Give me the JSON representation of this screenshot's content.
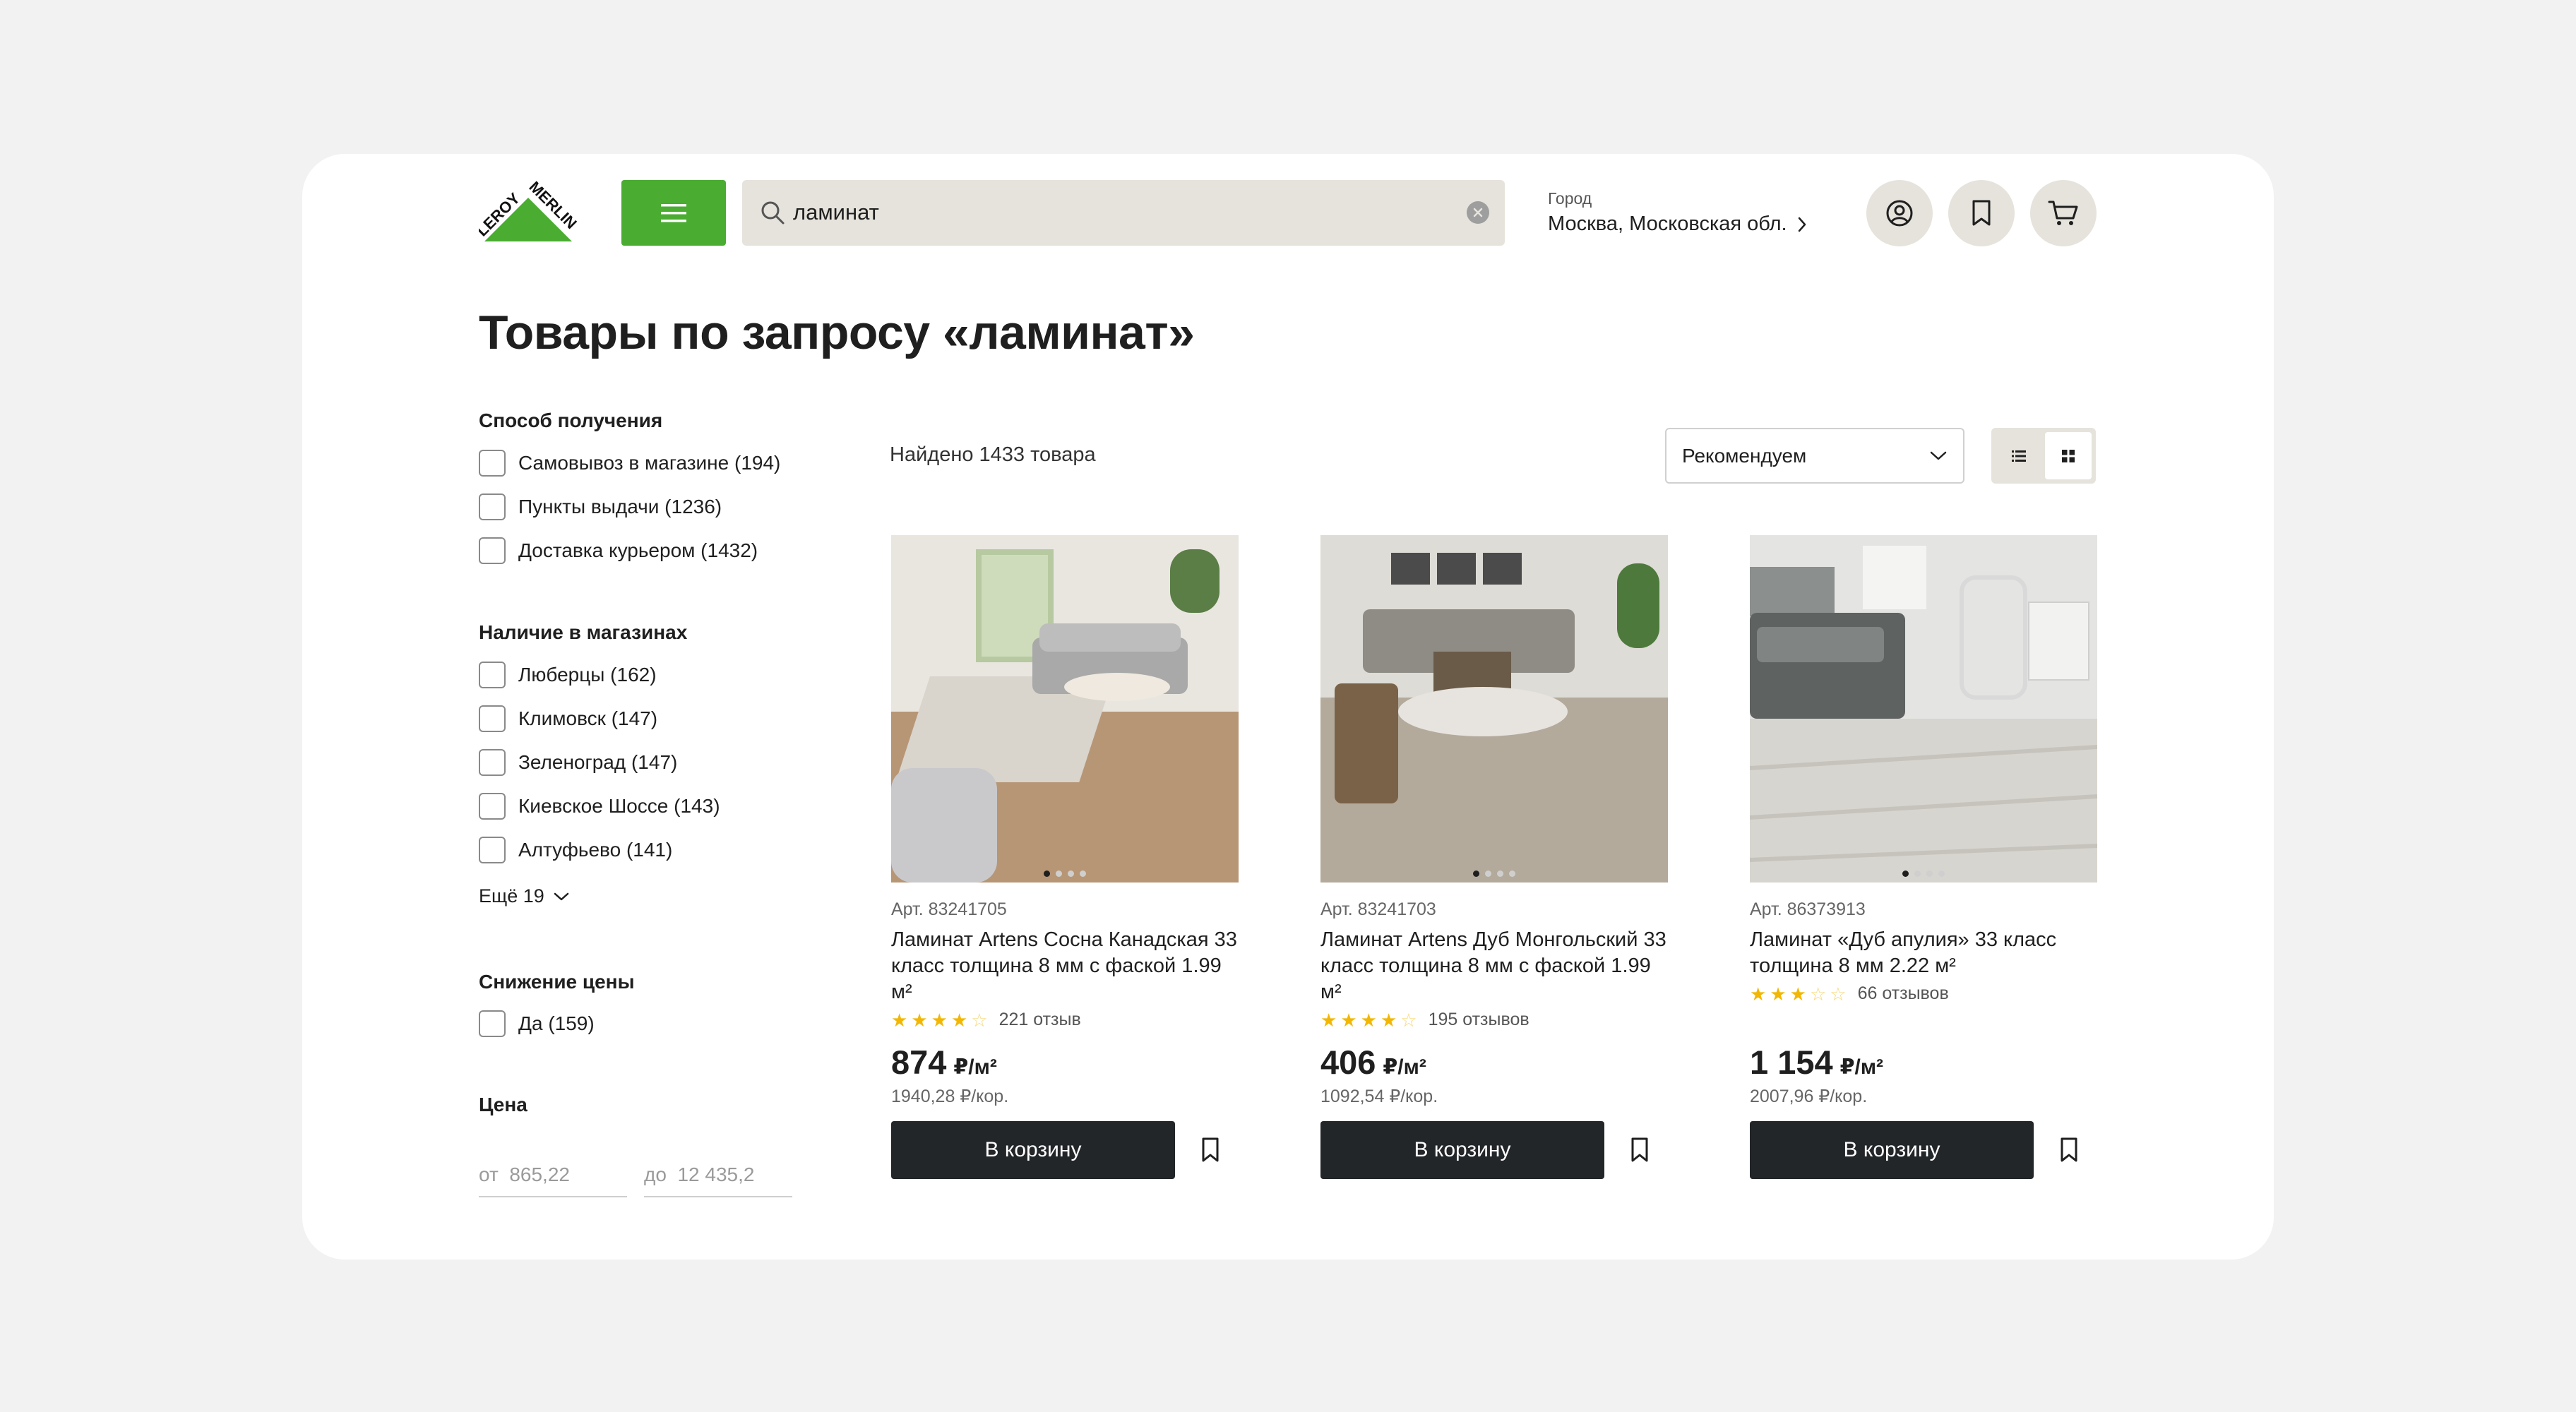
{
  "header": {
    "logo_text": "LEROY MERLIN",
    "search": {
      "value": "ламинат",
      "icon": "search-icon",
      "clear_icon": "clear-icon"
    },
    "city": {
      "label": "Город",
      "value": "Москва, Московская обл."
    },
    "icons": [
      "menu-icon",
      "profile-icon",
      "bookmark-icon",
      "cart-icon"
    ],
    "brand_color": "#4aad32"
  },
  "page_title": "Товары по запросу «ламинат»",
  "filters": {
    "delivery": {
      "title": "Способ получения",
      "items": [
        "Самовывоз в магазине (194)",
        "Пункты выдачи (1236)",
        "Доставка курьером (1432)"
      ]
    },
    "stores": {
      "title": "Наличие в магазинах",
      "items": [
        "Люберцы (162)",
        "Климовск (147)",
        "Зеленоград (147)",
        "Киевское Шоссе (143)",
        "Алтуфьево (141)"
      ],
      "more": "Ещё 19"
    },
    "discount": {
      "title": "Снижение цены",
      "items": [
        "Да (159)"
      ]
    },
    "price": {
      "title": "Цена",
      "from_placeholder": "от  865,22",
      "to_placeholder": "до  12 435,2"
    }
  },
  "toolbar": {
    "found": "Найдено 1433 товара",
    "sort": "Рекомендуем",
    "view_modes": [
      "list-view-icon",
      "grid-view-icon"
    ],
    "active_view": "grid"
  },
  "products": [
    {
      "art": "Арт. 83241705",
      "name": "Ламинат Artens Сосна Канадская 33 класс толщина 8 мм с фаской 1.99 м²",
      "stars": 4,
      "reviews": "221 отзыв",
      "price": "874",
      "unit": "₽/м²",
      "per_box": "1940,28 ₽/кор.",
      "button": "В корзину",
      "image_slides": 4,
      "active_slide": 1
    },
    {
      "art": "Арт. 83241703",
      "name": "Ламинат Artens Дуб Монгольский 33 класс толщина 8 мм с фаской 1.99 м²",
      "stars": 4,
      "reviews": "195 отзывов",
      "price": "406",
      "unit": "₽/м²",
      "per_box": "1092,54 ₽/кор.",
      "button": "В корзину",
      "image_slides": 4,
      "active_slide": 1
    },
    {
      "art": "Арт. 86373913",
      "name": "Ламинат «Дуб апулия» 33 класс толщина 8 мм 2.22 м²",
      "stars": 3,
      "reviews": "66 отзывов",
      "price": "1 154",
      "unit": "₽/м²",
      "per_box": "2007,96 ₽/кор.",
      "button": "В корзину",
      "image_slides": 4,
      "active_slide": 1
    }
  ]
}
